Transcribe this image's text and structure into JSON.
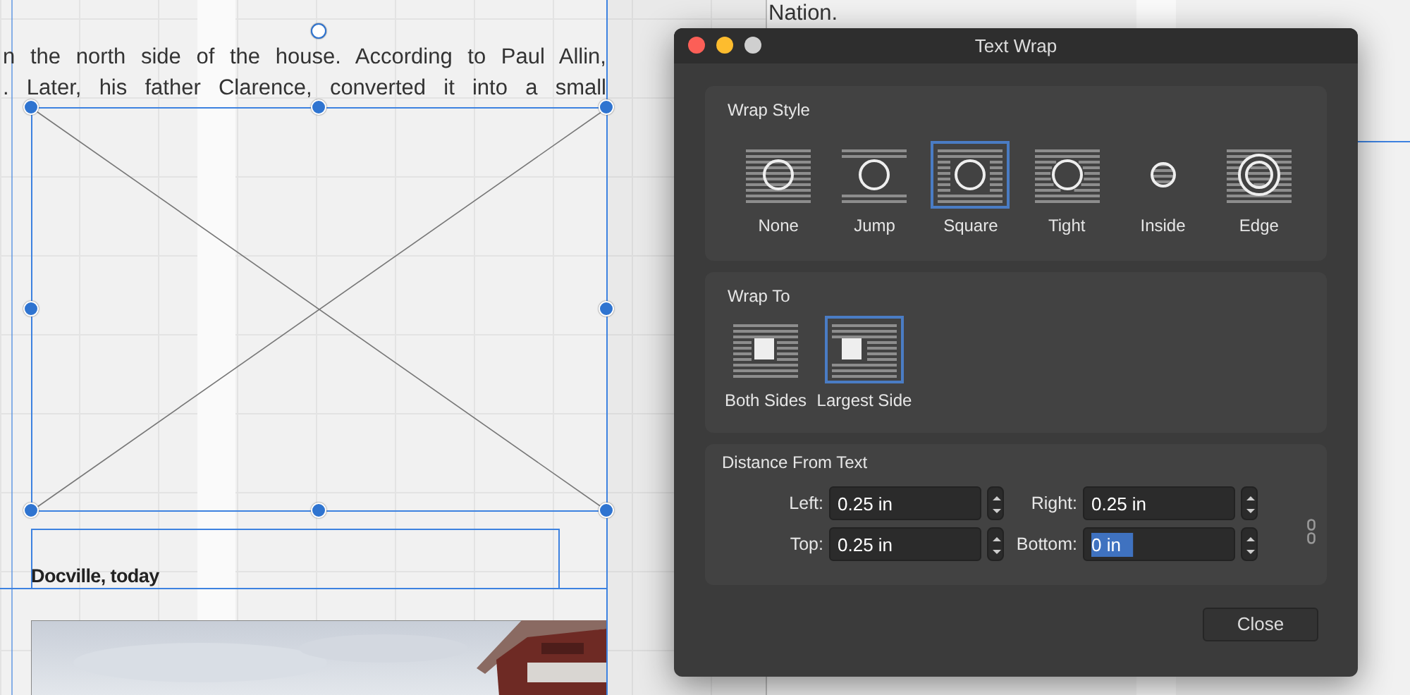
{
  "document": {
    "next_page_text": "Nation.",
    "text_lines": [
      "n the north side of the house. According to Paul Allin,",
      ". Later, his father Clarence, converted it into a small"
    ],
    "caption": "Docville, today"
  },
  "dialog": {
    "title": "Text Wrap",
    "wrap_style": {
      "label": "Wrap Style",
      "options": [
        {
          "label": "None",
          "kind": "none",
          "selected": false
        },
        {
          "label": "Jump",
          "kind": "jump",
          "selected": false
        },
        {
          "label": "Square",
          "kind": "square",
          "selected": true
        },
        {
          "label": "Tight",
          "kind": "tight",
          "selected": false
        },
        {
          "label": "Inside",
          "kind": "inside",
          "selected": false
        },
        {
          "label": "Edge",
          "kind": "edge",
          "selected": false
        }
      ]
    },
    "wrap_to": {
      "label": "Wrap To",
      "options": [
        {
          "label": "Both Sides",
          "kind": "both",
          "selected": false
        },
        {
          "label": "Largest Side",
          "kind": "largest",
          "selected": true
        }
      ]
    },
    "distance": {
      "label": "Distance From Text",
      "fields": [
        {
          "label": "Left:",
          "value": "0.25 in",
          "selected": false
        },
        {
          "label": "Right:",
          "value": "0.25 in",
          "selected": false
        },
        {
          "label": "Top:",
          "value": "0.25 in",
          "selected": false
        },
        {
          "label": "Bottom:",
          "value": "0 in",
          "selected": true
        }
      ]
    },
    "buttons": [
      {
        "label": "Close"
      }
    ]
  }
}
